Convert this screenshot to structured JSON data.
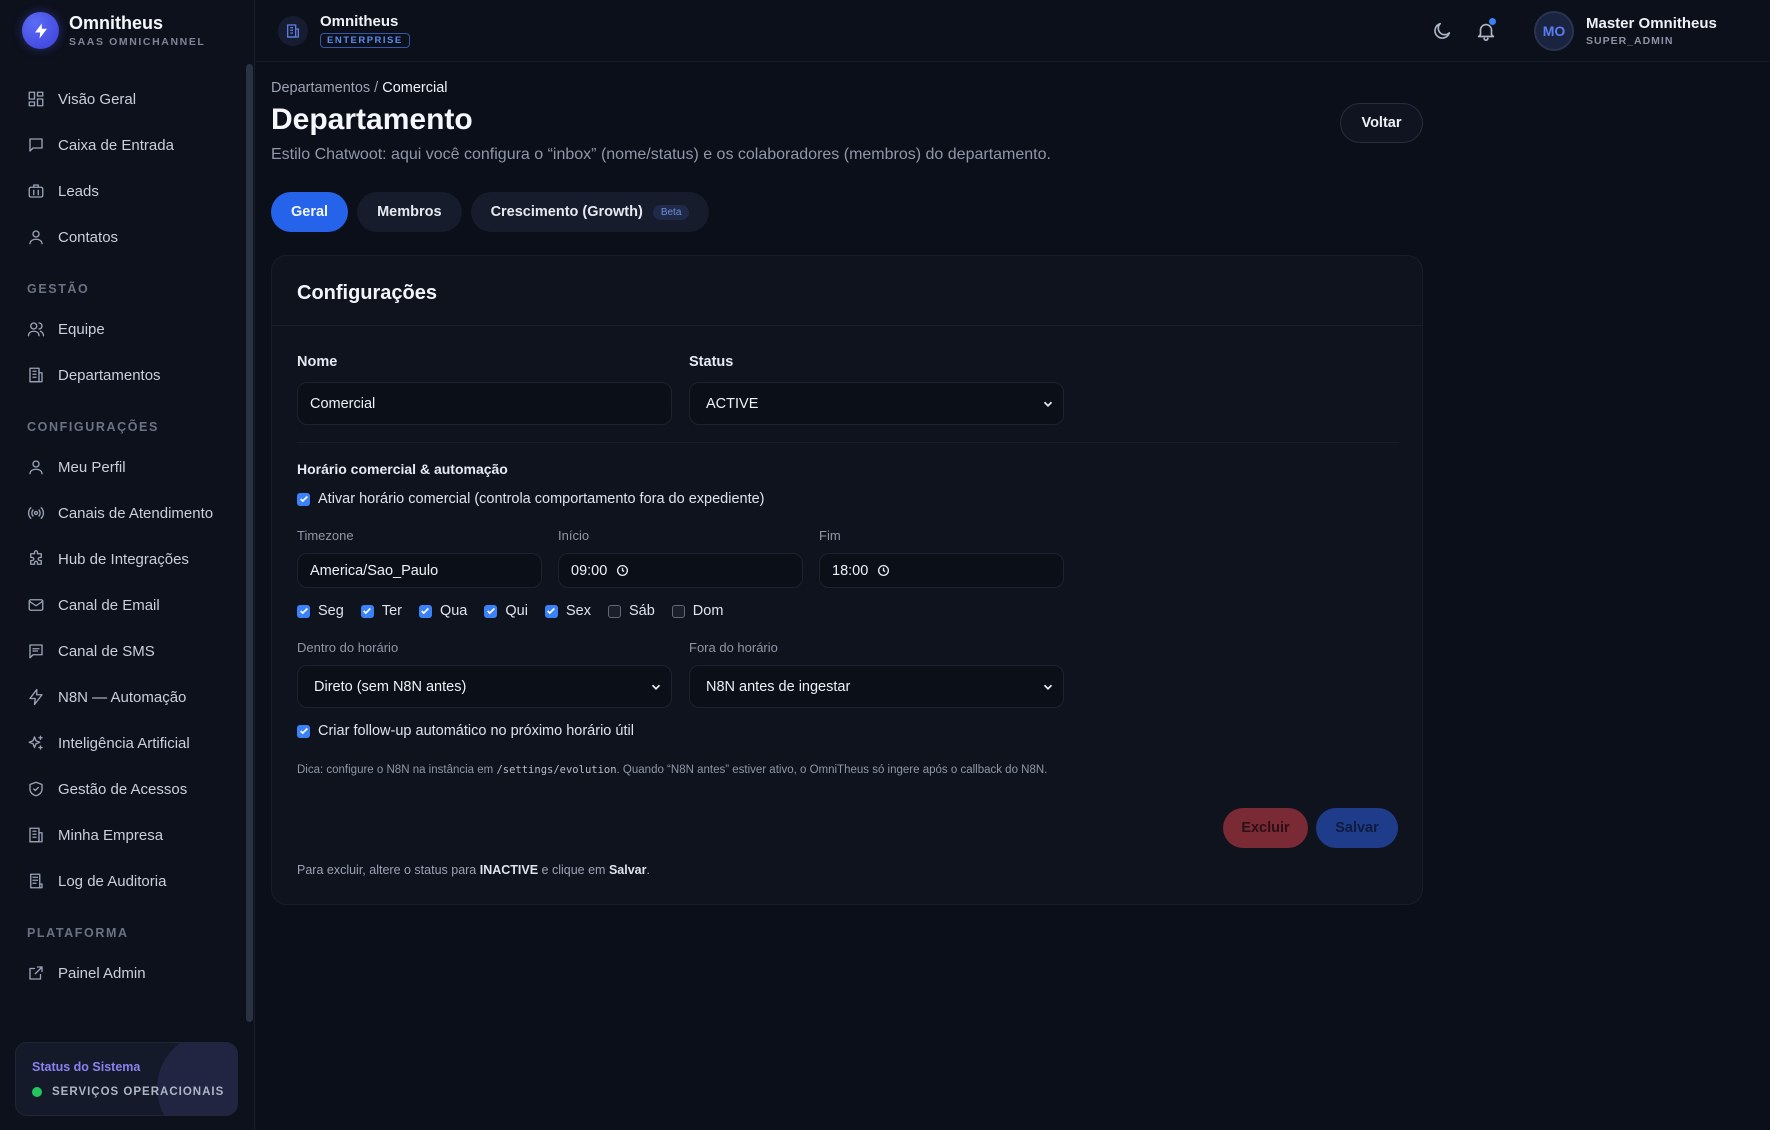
{
  "brand": {
    "title": "Omnitheus",
    "subtitle": "SAAS OMNICHANNEL"
  },
  "sidebar": {
    "main_items": [
      {
        "label": "Visão Geral",
        "icon": "dashboard-icon"
      },
      {
        "label": "Caixa de Entrada",
        "icon": "message-icon"
      },
      {
        "label": "Leads",
        "icon": "briefcase-icon"
      },
      {
        "label": "Contatos",
        "icon": "user-icon"
      }
    ],
    "section_gestao": "GESTÃO",
    "gestao_items": [
      {
        "label": "Equipe",
        "icon": "users-icon"
      },
      {
        "label": "Departamentos",
        "icon": "building-icon"
      }
    ],
    "section_config": "CONFIGURAÇÕES",
    "config_items": [
      {
        "label": "Meu Perfil",
        "icon": "user-icon"
      },
      {
        "label": "Canais de Atendimento",
        "icon": "radio-icon"
      },
      {
        "label": "Hub de Integrações",
        "icon": "puzzle-icon"
      },
      {
        "label": "Canal de Email",
        "icon": "mail-icon"
      },
      {
        "label": "Canal de SMS",
        "icon": "sms-icon"
      },
      {
        "label": "N8N — Automação",
        "icon": "bolt-icon"
      },
      {
        "label": "Inteligência Artificial",
        "icon": "sparkles-icon"
      },
      {
        "label": "Gestão de Acessos",
        "icon": "shield-icon"
      },
      {
        "label": "Minha Empresa",
        "icon": "building-icon"
      },
      {
        "label": "Log de Auditoria",
        "icon": "log-icon"
      }
    ],
    "section_platform": "PLATAFORMA",
    "platform_items": [
      {
        "label": "Painel Admin",
        "icon": "external-link-icon"
      }
    ],
    "status": {
      "title": "Status do Sistema",
      "text": "SERVIÇOS OPERACIONAIS",
      "color": "#22c55e"
    }
  },
  "header": {
    "workspace_name": "Omnitheus",
    "workspace_plan": "ENTERPRISE",
    "user_initials": "MO",
    "user_name": "Master Omnitheus",
    "user_role": "SUPER_ADMIN"
  },
  "page": {
    "breadcrumb_parent": "Departamentos",
    "breadcrumb_sep": " / ",
    "breadcrumb_current": "Comercial",
    "title": "Departamento",
    "description": "Estilo Chatwoot: aqui você configura o “inbox” (nome/status) e os colaboradores (membros) do departamento.",
    "back_button": "Voltar",
    "tabs": [
      {
        "label": "Geral",
        "active": true
      },
      {
        "label": "Membros",
        "active": false
      },
      {
        "label": "Crescimento (Growth)",
        "badge": "Beta",
        "active": false
      }
    ]
  },
  "form": {
    "card_title": "Configurações",
    "name_label": "Nome",
    "name_value": "Comercial",
    "status_label": "Status",
    "status_value": "ACTIVE",
    "hours_title": "Horário comercial & automação",
    "enable_hours_label": "Ativar horário comercial (controla comportamento fora do expediente)",
    "enable_hours_checked": true,
    "timezone_label": "Timezone",
    "timezone_value": "America/Sao_Paulo",
    "start_label": "Início",
    "start_value": "09:00",
    "end_label": "Fim",
    "end_value": "18:00",
    "days": [
      {
        "label": "Seg",
        "checked": true
      },
      {
        "label": "Ter",
        "checked": true
      },
      {
        "label": "Qua",
        "checked": true
      },
      {
        "label": "Qui",
        "checked": true
      },
      {
        "label": "Sex",
        "checked": true
      },
      {
        "label": "Sáb",
        "checked": false
      },
      {
        "label": "Dom",
        "checked": false
      }
    ],
    "inside_label": "Dentro do horário",
    "inside_value": "Direto (sem N8N antes)",
    "outside_label": "Fora do horário",
    "outside_value": "N8N antes de ingestar",
    "followup_label": "Criar follow-up automático no próximo horário útil",
    "followup_checked": true,
    "tip_prefix": "Dica: configure o N8N na instância em ",
    "tip_code": "/settings/evolution",
    "tip_suffix": ". Quando “N8N antes” estiver ativo, o OmniTheus só ingere após o callback do N8N.",
    "delete_button": "Excluir",
    "save_button": "Salvar",
    "footer_prefix": "Para excluir, altere o status para ",
    "footer_status": "INACTIVE",
    "footer_mid": " e clique em ",
    "footer_action": "Salvar",
    "footer_end": "."
  },
  "colors": {
    "accent": "#2563eb",
    "danger": "#7a2a35",
    "save": "#1e3c8a"
  }
}
